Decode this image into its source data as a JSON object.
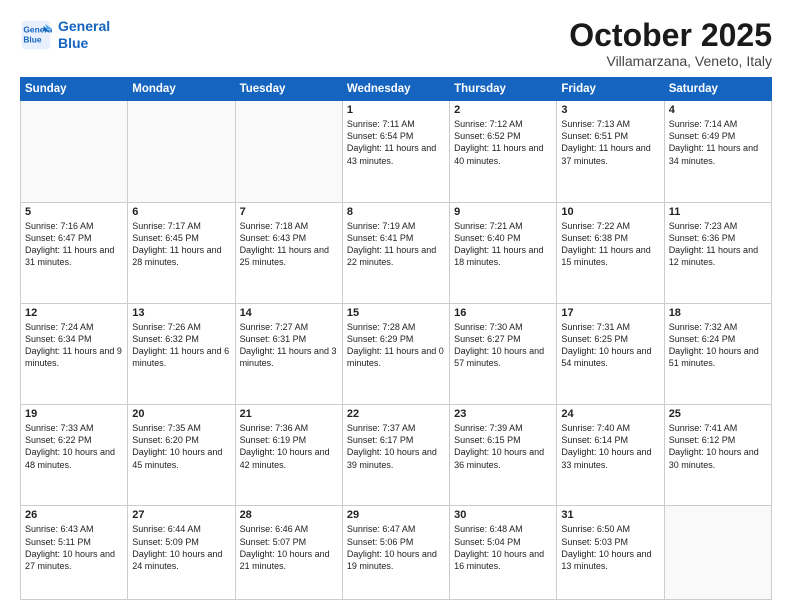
{
  "logo": {
    "line1": "General",
    "line2": "Blue"
  },
  "title": "October 2025",
  "location": "Villamarzana, Veneto, Italy",
  "weekdays": [
    "Sunday",
    "Monday",
    "Tuesday",
    "Wednesday",
    "Thursday",
    "Friday",
    "Saturday"
  ],
  "weeks": [
    [
      {
        "day": "",
        "info": ""
      },
      {
        "day": "",
        "info": ""
      },
      {
        "day": "",
        "info": ""
      },
      {
        "day": "1",
        "info": "Sunrise: 7:11 AM\nSunset: 6:54 PM\nDaylight: 11 hours\nand 43 minutes."
      },
      {
        "day": "2",
        "info": "Sunrise: 7:12 AM\nSunset: 6:52 PM\nDaylight: 11 hours\nand 40 minutes."
      },
      {
        "day": "3",
        "info": "Sunrise: 7:13 AM\nSunset: 6:51 PM\nDaylight: 11 hours\nand 37 minutes."
      },
      {
        "day": "4",
        "info": "Sunrise: 7:14 AM\nSunset: 6:49 PM\nDaylight: 11 hours\nand 34 minutes."
      }
    ],
    [
      {
        "day": "5",
        "info": "Sunrise: 7:16 AM\nSunset: 6:47 PM\nDaylight: 11 hours\nand 31 minutes."
      },
      {
        "day": "6",
        "info": "Sunrise: 7:17 AM\nSunset: 6:45 PM\nDaylight: 11 hours\nand 28 minutes."
      },
      {
        "day": "7",
        "info": "Sunrise: 7:18 AM\nSunset: 6:43 PM\nDaylight: 11 hours\nand 25 minutes."
      },
      {
        "day": "8",
        "info": "Sunrise: 7:19 AM\nSunset: 6:41 PM\nDaylight: 11 hours\nand 22 minutes."
      },
      {
        "day": "9",
        "info": "Sunrise: 7:21 AM\nSunset: 6:40 PM\nDaylight: 11 hours\nand 18 minutes."
      },
      {
        "day": "10",
        "info": "Sunrise: 7:22 AM\nSunset: 6:38 PM\nDaylight: 11 hours\nand 15 minutes."
      },
      {
        "day": "11",
        "info": "Sunrise: 7:23 AM\nSunset: 6:36 PM\nDaylight: 11 hours\nand 12 minutes."
      }
    ],
    [
      {
        "day": "12",
        "info": "Sunrise: 7:24 AM\nSunset: 6:34 PM\nDaylight: 11 hours\nand 9 minutes."
      },
      {
        "day": "13",
        "info": "Sunrise: 7:26 AM\nSunset: 6:32 PM\nDaylight: 11 hours\nand 6 minutes."
      },
      {
        "day": "14",
        "info": "Sunrise: 7:27 AM\nSunset: 6:31 PM\nDaylight: 11 hours\nand 3 minutes."
      },
      {
        "day": "15",
        "info": "Sunrise: 7:28 AM\nSunset: 6:29 PM\nDaylight: 11 hours\nand 0 minutes."
      },
      {
        "day": "16",
        "info": "Sunrise: 7:30 AM\nSunset: 6:27 PM\nDaylight: 10 hours\nand 57 minutes."
      },
      {
        "day": "17",
        "info": "Sunrise: 7:31 AM\nSunset: 6:25 PM\nDaylight: 10 hours\nand 54 minutes."
      },
      {
        "day": "18",
        "info": "Sunrise: 7:32 AM\nSunset: 6:24 PM\nDaylight: 10 hours\nand 51 minutes."
      }
    ],
    [
      {
        "day": "19",
        "info": "Sunrise: 7:33 AM\nSunset: 6:22 PM\nDaylight: 10 hours\nand 48 minutes."
      },
      {
        "day": "20",
        "info": "Sunrise: 7:35 AM\nSunset: 6:20 PM\nDaylight: 10 hours\nand 45 minutes."
      },
      {
        "day": "21",
        "info": "Sunrise: 7:36 AM\nSunset: 6:19 PM\nDaylight: 10 hours\nand 42 minutes."
      },
      {
        "day": "22",
        "info": "Sunrise: 7:37 AM\nSunset: 6:17 PM\nDaylight: 10 hours\nand 39 minutes."
      },
      {
        "day": "23",
        "info": "Sunrise: 7:39 AM\nSunset: 6:15 PM\nDaylight: 10 hours\nand 36 minutes."
      },
      {
        "day": "24",
        "info": "Sunrise: 7:40 AM\nSunset: 6:14 PM\nDaylight: 10 hours\nand 33 minutes."
      },
      {
        "day": "25",
        "info": "Sunrise: 7:41 AM\nSunset: 6:12 PM\nDaylight: 10 hours\nand 30 minutes."
      }
    ],
    [
      {
        "day": "26",
        "info": "Sunrise: 6:43 AM\nSunset: 5:11 PM\nDaylight: 10 hours\nand 27 minutes."
      },
      {
        "day": "27",
        "info": "Sunrise: 6:44 AM\nSunset: 5:09 PM\nDaylight: 10 hours\nand 24 minutes."
      },
      {
        "day": "28",
        "info": "Sunrise: 6:46 AM\nSunset: 5:07 PM\nDaylight: 10 hours\nand 21 minutes."
      },
      {
        "day": "29",
        "info": "Sunrise: 6:47 AM\nSunset: 5:06 PM\nDaylight: 10 hours\nand 19 minutes."
      },
      {
        "day": "30",
        "info": "Sunrise: 6:48 AM\nSunset: 5:04 PM\nDaylight: 10 hours\nand 16 minutes."
      },
      {
        "day": "31",
        "info": "Sunrise: 6:50 AM\nSunset: 5:03 PM\nDaylight: 10 hours\nand 13 minutes."
      },
      {
        "day": "",
        "info": ""
      }
    ]
  ]
}
